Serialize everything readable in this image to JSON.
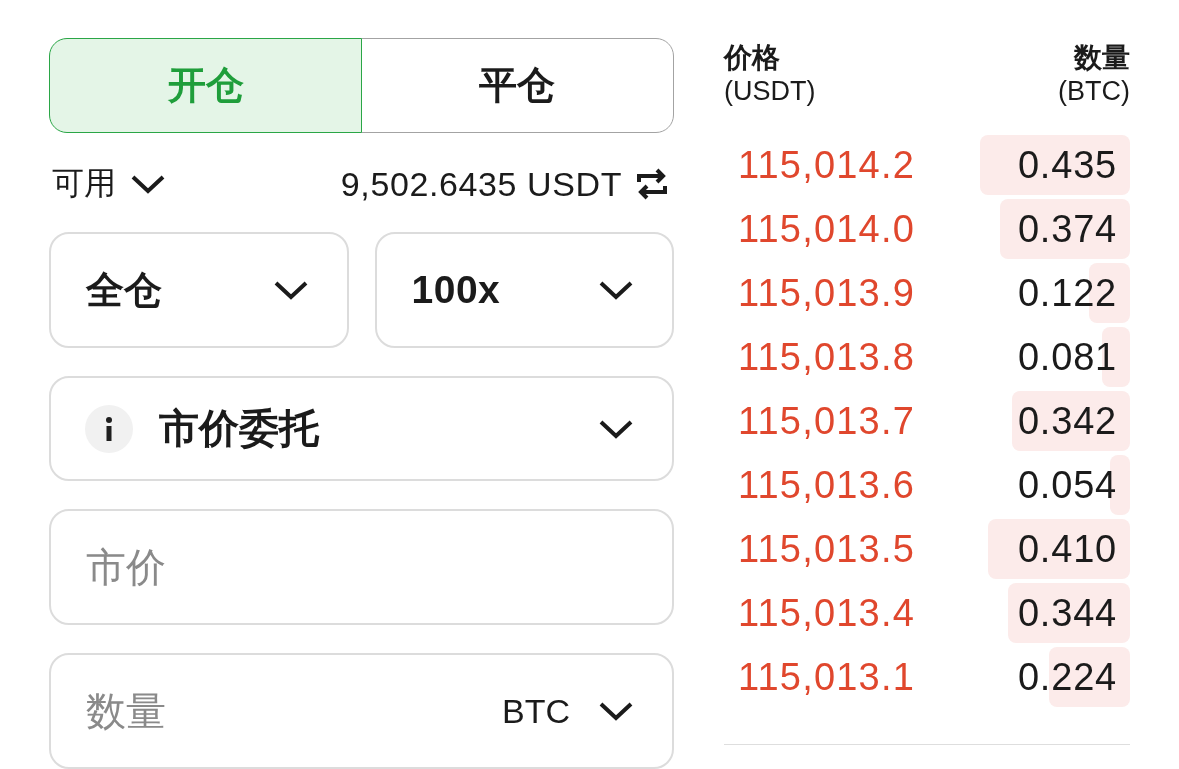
{
  "order_side_tabs": [
    {
      "label": "开仓",
      "selected": true
    },
    {
      "label": "平仓",
      "selected": false
    }
  ],
  "available": {
    "label": "可用",
    "balance": "9,502.6435 USDT"
  },
  "margin_mode": {
    "value": "全仓"
  },
  "leverage": {
    "value": "100x"
  },
  "order_type": {
    "value": "市价委托"
  },
  "price_field": {
    "placeholder": "市价"
  },
  "amount_field": {
    "placeholder": "数量",
    "unit": "BTC"
  },
  "order_book": {
    "columns": [
      {
        "title": "价格",
        "unit": "(USDT)"
      },
      {
        "title": "数量",
        "unit": "(BTC)"
      }
    ],
    "asks": [
      {
        "price": "115,014.2",
        "amount": "0.435",
        "level": 0.37
      },
      {
        "price": "115,014.0",
        "amount": "0.374",
        "level": 0.32
      },
      {
        "price": "115,013.9",
        "amount": "0.122",
        "level": 0.1
      },
      {
        "price": "115,013.8",
        "amount": "0.081",
        "level": 0.07
      },
      {
        "price": "115,013.7",
        "amount": "0.342",
        "level": 0.29
      },
      {
        "price": "115,013.6",
        "amount": "0.054",
        "level": 0.05
      },
      {
        "price": "115,013.5",
        "amount": "0.410",
        "level": 0.35
      },
      {
        "price": "115,013.4",
        "amount": "0.344",
        "level": 0.3
      },
      {
        "price": "115,013.1",
        "amount": "0.224",
        "level": 0.2
      }
    ]
  }
}
